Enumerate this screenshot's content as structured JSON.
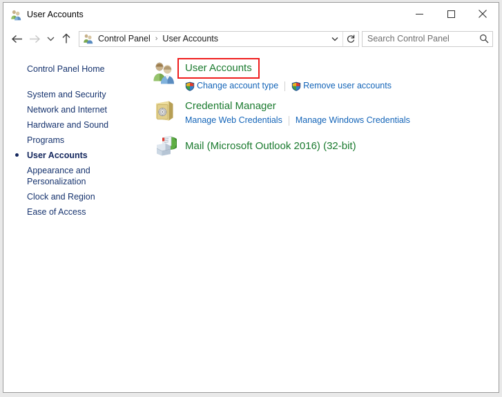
{
  "window": {
    "title": "User Accounts",
    "title_icon": "user-accounts-icon",
    "minimize_label": "Minimize",
    "maximize_label": "Maximize",
    "close_label": "Close"
  },
  "navbar": {
    "back_label": "Back",
    "forward_label": "Forward",
    "recent_label": "Recent locations",
    "up_label": "Up one level",
    "breadcrumb": {
      "icon": "user-accounts-icon",
      "items": [
        "Control Panel",
        "User Accounts"
      ],
      "separator": "›"
    },
    "dropdown_label": "Previous locations",
    "refresh_label": "Refresh"
  },
  "search": {
    "placeholder": "Search Control Panel",
    "value": "",
    "icon": "search-icon"
  },
  "sidebar": {
    "home": "Control Panel Home",
    "items": [
      {
        "label": "System and Security",
        "current": false
      },
      {
        "label": "Network and Internet",
        "current": false
      },
      {
        "label": "Hardware and Sound",
        "current": false
      },
      {
        "label": "Programs",
        "current": false
      },
      {
        "label": "User Accounts",
        "current": true
      },
      {
        "label": "Appearance and Personalization",
        "current": false
      },
      {
        "label": "Clock and Region",
        "current": false
      },
      {
        "label": "Ease of Access",
        "current": false
      }
    ]
  },
  "content": {
    "categories": [
      {
        "title": "User Accounts",
        "icon": "user-accounts-icon",
        "highlighted": true,
        "links": [
          {
            "label": "Change account type",
            "shield": true
          },
          {
            "label": "Remove user accounts",
            "shield": true
          }
        ]
      },
      {
        "title": "Credential Manager",
        "icon": "credential-vault-icon",
        "highlighted": false,
        "links": [
          {
            "label": "Manage Web Credentials",
            "shield": false
          },
          {
            "label": "Manage Windows Credentials",
            "shield": false
          }
        ]
      },
      {
        "title": "Mail (Microsoft Outlook 2016) (32-bit)",
        "icon": "mail-icon",
        "highlighted": false,
        "links": []
      }
    ]
  },
  "colors": {
    "category_title": "#1a7a2e",
    "link": "#1364b8",
    "sidebar_text": "#16336e",
    "highlight_box": "#ef1c1c"
  }
}
